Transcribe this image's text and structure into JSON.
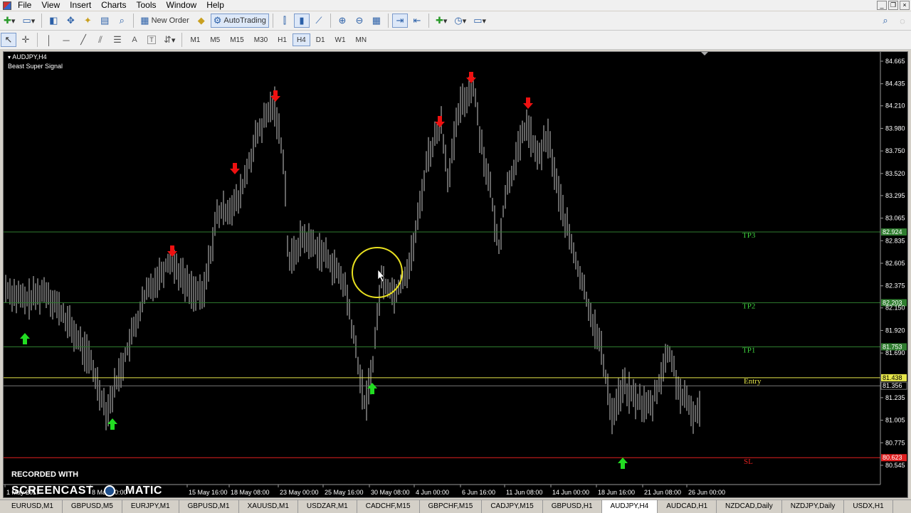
{
  "menu": [
    "File",
    "View",
    "Insert",
    "Charts",
    "Tools",
    "Window",
    "Help"
  ],
  "toolbar": {
    "new_order": "New Order",
    "autotrading": "AutoTrading"
  },
  "timeframes": [
    "M1",
    "M5",
    "M15",
    "M30",
    "H1",
    "H4",
    "D1",
    "W1",
    "MN"
  ],
  "chart": {
    "symbol": "AUDJPY,H4",
    "indicator": "Beast Super Signal",
    "price_labels": [
      "84.665",
      "84.435",
      "84.210",
      "83.980",
      "83.750",
      "83.520",
      "83.295",
      "83.065",
      "82.835",
      "82.605",
      "82.375",
      "82.150",
      "81.920",
      "81.690",
      "81.235",
      "81.005",
      "80.775",
      "80.545"
    ],
    "highlighted_prices": {
      "tp3": "82.924",
      "tp2": "82.203",
      "tp1": "81.753",
      "entry": "81.438",
      "bid": "81.356",
      "sl": "80.623"
    },
    "line_labels": {
      "tp3": "TP3",
      "tp2": "TP2",
      "tp1": "TP1",
      "entry": "Entry",
      "sl": "SL"
    },
    "time_labels": [
      "1 May 2017",
      "8 May 00:00",
      "15 May 16:00",
      "18 May 08:00",
      "23 May 00:00",
      "25 May 16:00",
      "30 May 08:00",
      "4 Jun 00:00",
      "6 Jun 16:00",
      "11 Jun 08:00",
      "14 Jun 00:00",
      "18 Jun 16:00",
      "21 Jun 08:00",
      "26 Jun 00:00"
    ],
    "colors": {
      "bg": "#000000",
      "candle": "#c8c8c8",
      "tp": "#2f7d2f",
      "entry": "#e6e64a",
      "sl": "#e02020",
      "buy": "#22dd22",
      "sell": "#ee1111"
    }
  },
  "watermark": {
    "line1": "RECORDED WITH",
    "line2": "SCREENCAST",
    "line3": "MATIC"
  },
  "tabs": [
    "EURUSD,M1",
    "GBPUSD,M5",
    "EURJPY,M1",
    "GBPUSD,M1",
    "XAUUSD,M1",
    "USDZAR,M1",
    "CADCHF,M15",
    "GBPCHF,M15",
    "CADJPY,M15",
    "GBPUSD,H1",
    "AUDJPY,H4",
    "AUDCAD,H1",
    "NZDCAD,Daily",
    "NZDJPY,Daily",
    "USDX,H1"
  ],
  "active_tab": "AUDJPY,H4"
}
